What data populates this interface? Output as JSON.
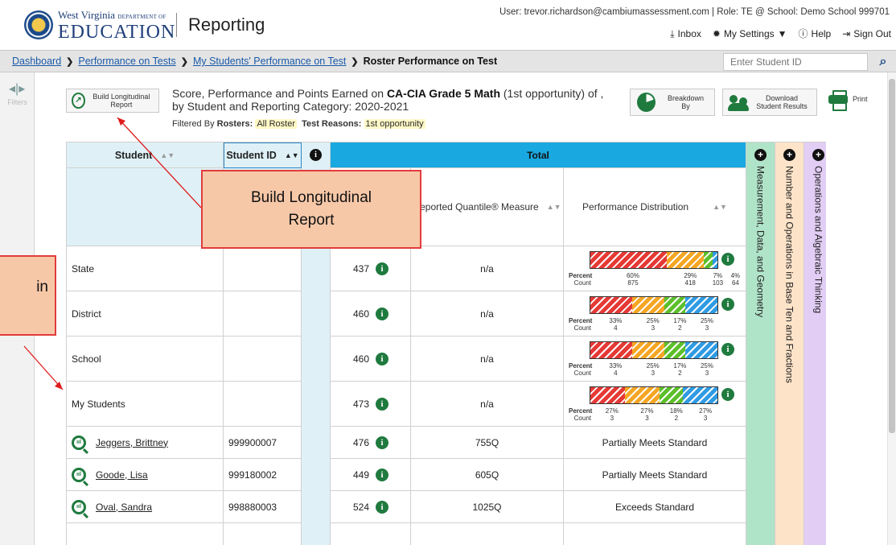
{
  "header": {
    "brand_top": "West Virginia",
    "brand_top_small": "DEPARTMENT OF",
    "brand_main": "EDUCATION",
    "app_title": "Reporting",
    "user_line": "User: trevor.richardson@cambiumassessment.com  | Role: TE @ School: Demo School 999701",
    "links": {
      "inbox": "Inbox",
      "settings": "My Settings",
      "help": "Help",
      "signout": "Sign Out"
    }
  },
  "breadcrumb": {
    "items": [
      "Dashboard",
      "Performance on Tests",
      "My Students' Performance on Test"
    ],
    "current": "Roster Performance on Test",
    "student_id_placeholder": "Enter Student ID"
  },
  "rail": {
    "filters_label": "Filters"
  },
  "toolbar": {
    "build_longitudinal": "Build Longitudinal Report",
    "breakdown_by": "Breakdown By",
    "download": "Download Student Results",
    "print": "Print"
  },
  "report": {
    "title_pre": "Score, Performance and Points Earned on ",
    "title_bold": "CA-CIA Grade 5 Math",
    "title_post": " (1st opportunity) of ,",
    "title_line2": "by Student and Reporting Category: 2020-2021",
    "filtered_by_label": "Filtered By",
    "rosters_label": "Rosters:",
    "rosters_value": "All Roster",
    "reasons_label": "Test Reasons:",
    "reasons_value": "1st opportunity"
  },
  "table": {
    "headers": {
      "student": "Student",
      "student_id": "Student ID",
      "total": "Total",
      "quantile": "Reported Quantile® Measure",
      "perf_dist": "Performance Distribution",
      "cat1": "Measurement, Data, and Geometry",
      "cat2": "Number and Operations in Base Ten and Fractions",
      "cat3": "Operations and Algebraic Thinking"
    },
    "colors": {
      "red": "#e53935",
      "orange": "#f5a623",
      "green": "#5cbf2a",
      "blue": "#2f9be3"
    },
    "aggregate_rows": [
      {
        "name": "State",
        "score": "437",
        "quantile": "n/a",
        "pcts": [
          "60%",
          "29%",
          "7%",
          "4%"
        ],
        "counts": [
          "875",
          "418",
          "103",
          "64"
        ],
        "shares": [
          60,
          29,
          7,
          4
        ]
      },
      {
        "name": "District",
        "score": "460",
        "quantile": "n/a",
        "pcts": [
          "33%",
          "25%",
          "17%",
          "25%"
        ],
        "counts": [
          "4",
          "3",
          "2",
          "3"
        ],
        "shares": [
          33,
          25,
          17,
          25
        ]
      },
      {
        "name": "School",
        "score": "460",
        "quantile": "n/a",
        "pcts": [
          "33%",
          "25%",
          "17%",
          "25%"
        ],
        "counts": [
          "4",
          "3",
          "2",
          "3"
        ],
        "shares": [
          33,
          25,
          17,
          25
        ]
      },
      {
        "name": "My Students",
        "score": "473",
        "quantile": "n/a",
        "pcts": [
          "27%",
          "27%",
          "18%",
          "27%"
        ],
        "counts": [
          "3",
          "3",
          "2",
          "3"
        ],
        "shares": [
          27,
          27,
          18,
          27
        ]
      }
    ],
    "percent_label": "Percent",
    "count_label": "Count",
    "student_rows": [
      {
        "name": "Jeggers, Brittney",
        "id": "999900007",
        "score": "476",
        "quantile": "755Q",
        "perf": "Partially Meets Standard"
      },
      {
        "name": "Goode, Lisa",
        "id": "999180002",
        "score": "449",
        "quantile": "605Q",
        "perf": "Partially Meets Standard"
      },
      {
        "name": "Oval, Sandra",
        "id": "998880003",
        "score": "524",
        "quantile": "1025Q",
        "perf": "Exceeds Standard"
      }
    ]
  },
  "callouts": {
    "build": "Build Longitudinal Report",
    "left": "in"
  }
}
